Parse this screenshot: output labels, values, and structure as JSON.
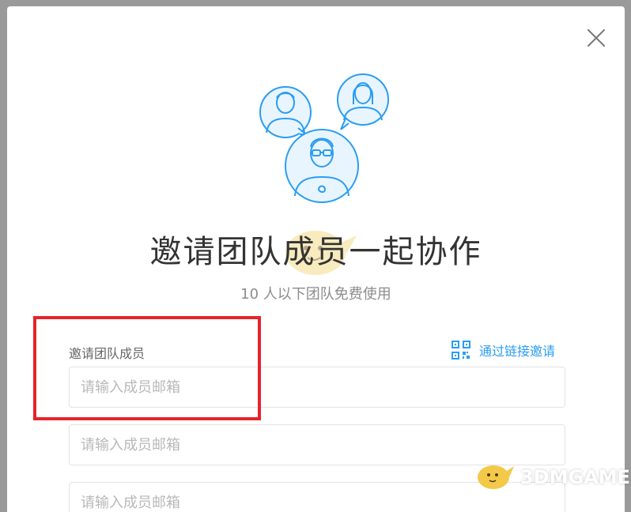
{
  "dialog": {
    "title": "邀请团队成员一起协作",
    "subtitle": "10 人以下团队免费使用",
    "section_label": "邀请团队成员",
    "link_invite_label": "通过链接邀请",
    "inputs": [
      {
        "placeholder": "请输入成员邮箱",
        "value": ""
      },
      {
        "placeholder": "请输入成员邮箱",
        "value": ""
      },
      {
        "placeholder": "请输入成员邮箱",
        "value": ""
      }
    ],
    "icons": {
      "close": "close-icon",
      "qr": "qr-code-icon",
      "illustration": "team-members-illustration"
    }
  },
  "watermark": {
    "text": "3DMGAME"
  },
  "colors": {
    "accent": "#2a9df4",
    "highlight_box": "#e8232b",
    "overlay": "#9a9a9a"
  }
}
